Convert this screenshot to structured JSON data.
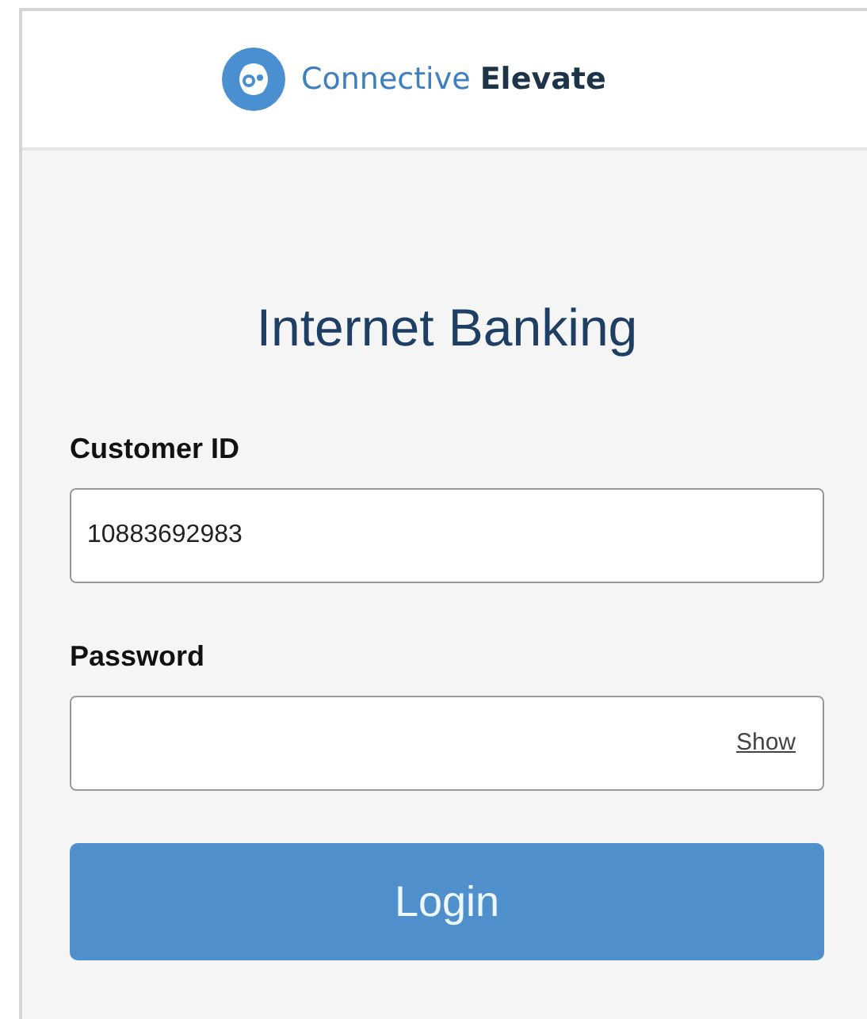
{
  "header": {
    "brand_first": "Connective",
    "brand_second": "Elevate"
  },
  "title": "Internet Banking",
  "fields": [
    {
      "label": "Customer ID",
      "value": "10883692983"
    },
    {
      "label": "Password",
      "toggle": "Show"
    }
  ],
  "button": "Login"
}
